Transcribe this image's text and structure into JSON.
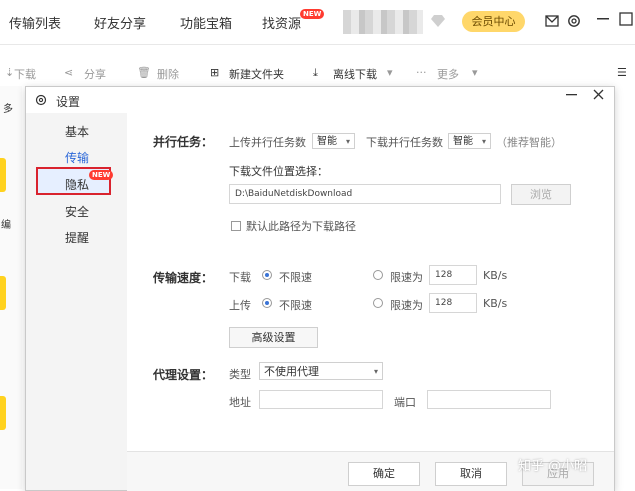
{
  "nav": {
    "items": [
      "传输列表",
      "好友分享",
      "功能宝箱",
      "找资源"
    ],
    "new_badge": "NEW",
    "vip_label": "会员中心"
  },
  "toolbar": {
    "download": "下载",
    "share": "分享",
    "delete": "删除",
    "new_folder": "新建文件夹",
    "offline_download": "离线下载",
    "more": "更多"
  },
  "left_strip_text": [
    "多",
    "编"
  ],
  "dialog": {
    "title": "设置",
    "sidebar": [
      "基本",
      "传输",
      "隐私",
      "安全",
      "提醒"
    ],
    "privacy_badge": "NEW",
    "parallel": {
      "label": "并行任务：",
      "upload_label": "上传并行任务数",
      "upload_value": "智能",
      "download_label": "下载并行任务数",
      "download_value": "智能",
      "hint": "（推荐智能）"
    },
    "download_path": {
      "label": "下载文件位置选择：",
      "value": "D:\\BaiduNetdiskDownload",
      "browse": "浏览",
      "default_checkbox": "默认此路径为下载路径"
    },
    "speed": {
      "label": "传输速度：",
      "download_label": "下载",
      "upload_label": "上传",
      "unlimited": "不限速",
      "limited": "限速为",
      "download_limit": "128",
      "upload_limit": "128",
      "unit": "KB/s",
      "advanced": "高级设置"
    },
    "proxy": {
      "label": "代理设置：",
      "type_label": "类型",
      "type_value": "不使用代理",
      "address_label": "地址",
      "port_label": "端口"
    },
    "buttons": {
      "ok": "确定",
      "cancel": "取消",
      "apply": "应用"
    }
  },
  "watermark": "知乎 @小昭"
}
